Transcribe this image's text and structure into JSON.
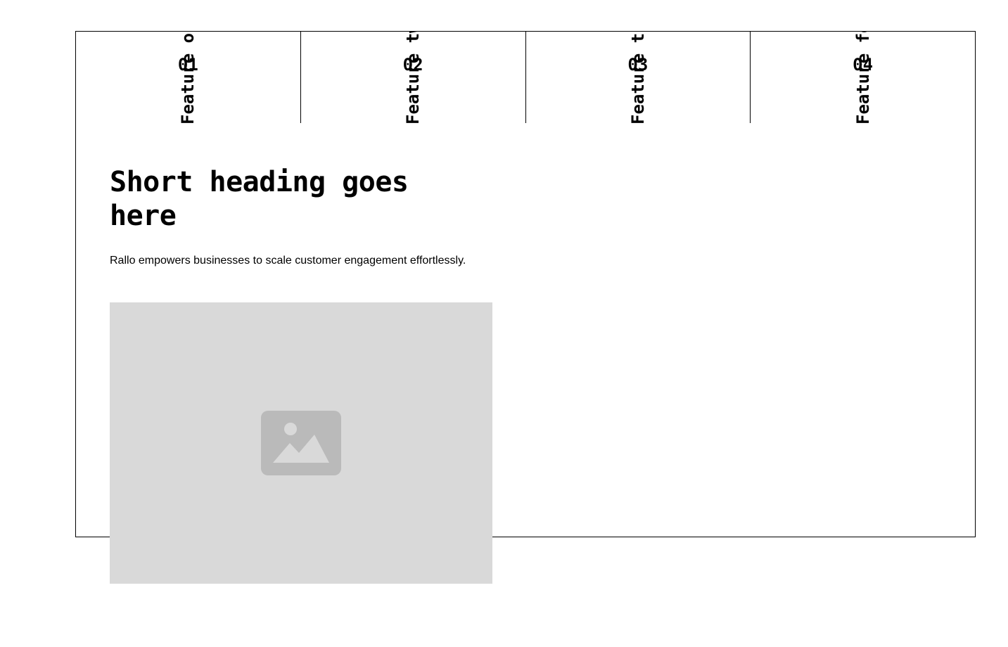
{
  "tabs": [
    {
      "number": "01",
      "label": "Feature one"
    },
    {
      "number": "02",
      "label": "Feature two"
    },
    {
      "number": "03",
      "label": "Feature three"
    },
    {
      "number": "04",
      "label": "Feature four"
    }
  ],
  "content": {
    "heading": "Short heading goes here",
    "description": "Rallo empowers businesses to scale customer engagement effortlessly.",
    "image_icon": "image-placeholder-icon"
  },
  "colors": {
    "border": "#000000",
    "placeholder_bg": "#d9d9d9",
    "placeholder_icon": "#bababa"
  }
}
